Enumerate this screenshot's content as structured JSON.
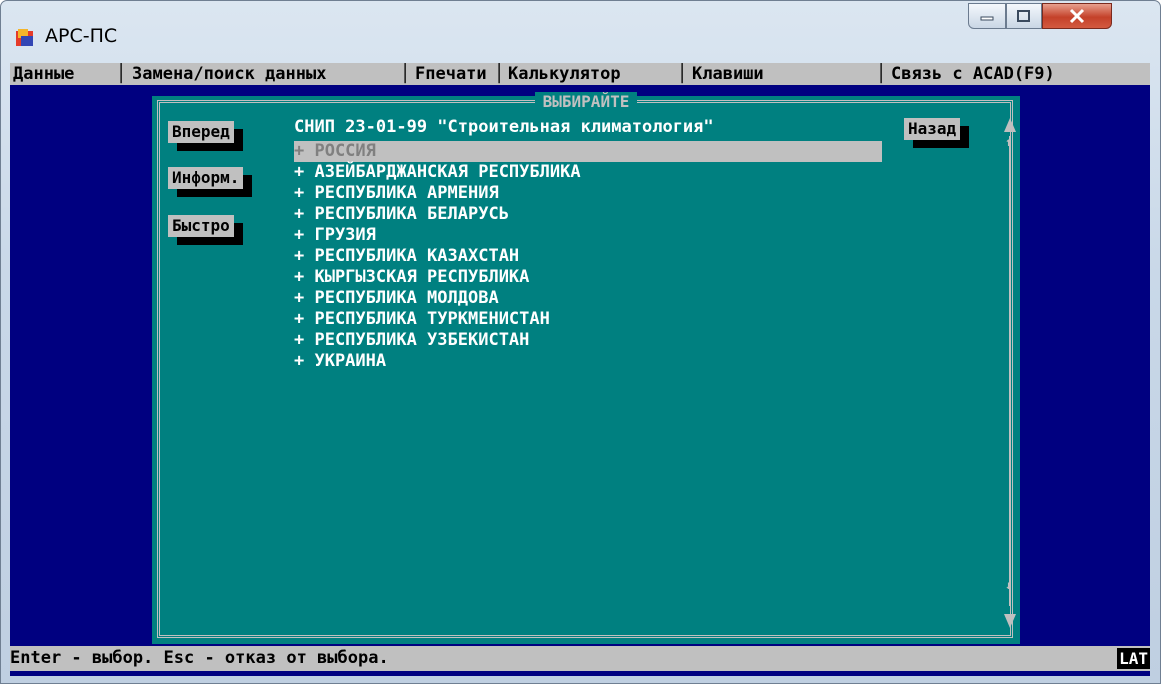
{
  "window": {
    "title": "АРС-ПС"
  },
  "menu": [
    {
      "label": "Данные"
    },
    {
      "label": "Замена/поиск данных"
    },
    {
      "label": "Fпечати"
    },
    {
      "label": "Калькулятор"
    },
    {
      "label": "Клавиши"
    },
    {
      "label": "Связь с ACAD(F9)"
    }
  ],
  "dialog": {
    "title": "ВЫБИРАЙТЕ",
    "heading": "СНИП 23-01-99 \"Строительная климатология\"",
    "buttons": {
      "forward": "Вперед",
      "info": "Информ.",
      "fast": "Быстро",
      "back": "Назад"
    },
    "items": [
      "+ РОССИЯ",
      "+ АЗЕЙБАРДЖАНСКАЯ РЕСПУБЛИКА",
      "+ РЕСПУБЛИКА АРМЕНИЯ",
      "+ РЕСПУБЛИКА БЕЛАРУСЬ",
      "+ ГРУЗИЯ",
      "+ РЕСПУБЛИКА КАЗАХСТАН",
      "+ КЫРГЫЗСКАЯ РЕСПУБЛИКА",
      "+ РЕСПУБЛИКА МОЛДОВА",
      "+ РЕСПУБЛИКА ТУРКМЕНИСТАН",
      "+ РЕСПУБЛИКА УЗБЕКИСТАН",
      "+ УКРАИНА"
    ],
    "selected_index": 0
  },
  "status": {
    "hint": "Enter - выбор. Esc - отказ от выбора.",
    "keyboard": "LAT"
  },
  "colors": {
    "desktop": "#000080",
    "dialog": "#008080",
    "bar": "#c0c0c0"
  }
}
